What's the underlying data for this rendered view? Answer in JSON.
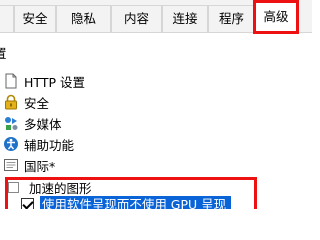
{
  "tabs": [
    {
      "label": "",
      "active": false
    },
    {
      "label": "安全",
      "active": false
    },
    {
      "label": "隐私",
      "active": false
    },
    {
      "label": "内容",
      "active": false
    },
    {
      "label": "连接",
      "active": false
    },
    {
      "label": "程序",
      "active": false
    },
    {
      "label": "高级",
      "active": true
    }
  ],
  "settings": {
    "heading": "置",
    "items": [
      {
        "label": "HTTP 设置",
        "icon": "document-icon"
      },
      {
        "label": "安全",
        "icon": "lock-icon"
      },
      {
        "label": "多媒体",
        "icon": "multimedia-icon"
      },
      {
        "label": "辅助功能",
        "icon": "accessibility-icon"
      },
      {
        "label": "国际*",
        "icon": "document-icon"
      }
    ],
    "subgroup": {
      "label": "加速的图形"
    },
    "option": {
      "label": "使用软件呈现而不使用 GPU 呈现*",
      "checked": true
    }
  },
  "colors": {
    "highlight_border": "#ee1111",
    "selection": "#0a64d8"
  }
}
